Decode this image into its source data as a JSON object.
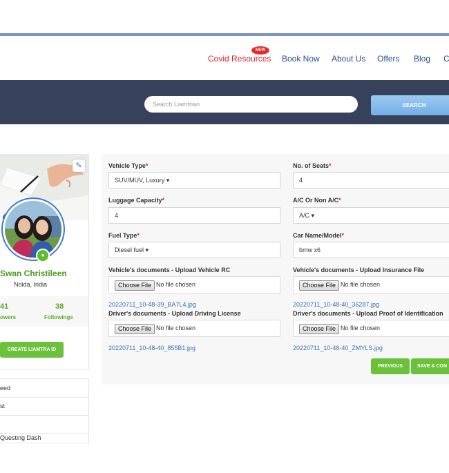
{
  "nav": {
    "items": [
      {
        "label": "Covid Resources",
        "badge": "NEW"
      },
      {
        "label": "Book Now"
      },
      {
        "label": "About Us"
      },
      {
        "label": "Offers"
      },
      {
        "label": "Blog"
      },
      {
        "label": "Co"
      }
    ]
  },
  "search": {
    "placeholder": "Search Liamtrian",
    "button_label": "SEARCH"
  },
  "profile": {
    "name": "Swan Christileen",
    "location": "Noida, India",
    "followers_count": "41",
    "followers_label": "owers",
    "followings_count": "38",
    "followings_label": "Followings",
    "create_button": "CREATE LIAMTRA ID"
  },
  "side_menu": {
    "items": [
      "eed",
      "st",
      "",
      "Questing Dash"
    ]
  },
  "form": {
    "vehicle_type": {
      "label": "Vehicle Type",
      "value": "SUV/MUV, Luxury ▾"
    },
    "seats": {
      "label": "No. of Seats",
      "value": "4"
    },
    "luggage": {
      "label": "Luggage Capacity",
      "value": "4"
    },
    "ac": {
      "label": "A/C Or Non A/C",
      "value": "A/C ▾"
    },
    "fuel": {
      "label": "Fuel Type",
      "value": "Diesel fuel ▾"
    },
    "car_name": {
      "label": "Car Name/Model",
      "value": "bmw x6"
    },
    "rc_doc": {
      "label": "Vehicle's documents - Upload Vehicle RC",
      "file": "20220711_10-48-39_BA7L4.jpg"
    },
    "insurance_doc": {
      "label": "Vehicle's documents - Upload Insurance File",
      "file": "20220711_10-48-40_36287.jpg"
    },
    "license_doc": {
      "label": "Driver's documents - Upload Driving License",
      "file": "20220711_10-48-40_855B1.jpg"
    },
    "id_doc": {
      "label": "Driver's documents - Upload Proof of Identification",
      "file": "20220711_10-48-40_ZMYLS.jpg"
    },
    "choose_file_label": "Choose File",
    "no_file_label": "No file chosen",
    "required_mark": "*",
    "previous_button": "PREVIOUS",
    "save_button": "SAVE & CON"
  },
  "colors": {
    "accent_green": "#6cc13b",
    "search_bar_bg": "#37415c",
    "nav_link": "#2a4d8f",
    "covid_red": "#d9232d"
  }
}
